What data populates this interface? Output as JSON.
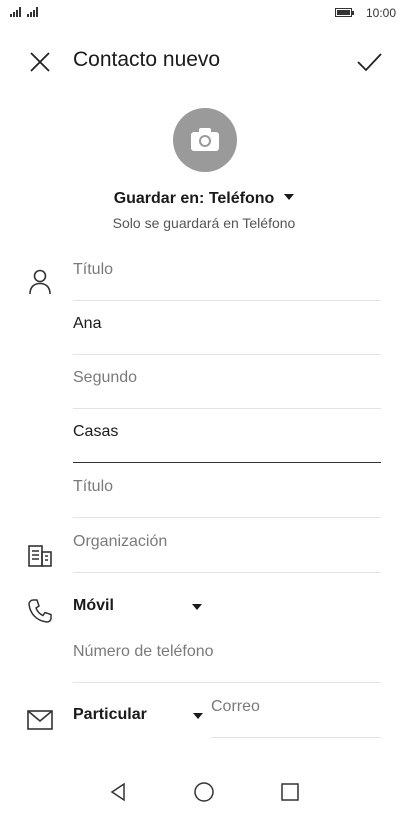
{
  "status_bar": {
    "time": "10:00"
  },
  "app_bar": {
    "title": "Contacto nuevo"
  },
  "account": {
    "label": "Guardar en: Teléfono",
    "note": "Solo se guardará en Teléfono"
  },
  "name_fields": [
    {
      "value": "",
      "placeholder": "Título"
    },
    {
      "value": "Ana",
      "placeholder": ""
    },
    {
      "value": "",
      "placeholder": "Segundo"
    },
    {
      "value": "Casas",
      "placeholder": ""
    },
    {
      "value": "",
      "placeholder": "Título"
    }
  ],
  "organization": {
    "placeholder": "Organización"
  },
  "phone": {
    "type": "Móvil",
    "placeholder": "Número de teléfono"
  },
  "email": {
    "type": "Particular",
    "placeholder": "Correo"
  },
  "icons": {
    "close": "close-icon",
    "save": "check-icon",
    "photo": "camera-icon",
    "person": "person-icon",
    "organization": "building-icon",
    "phone": "phone-icon",
    "email": "mail-icon",
    "back": "back-triangle-icon",
    "home": "home-circle-icon",
    "recents": "recents-square-icon"
  }
}
